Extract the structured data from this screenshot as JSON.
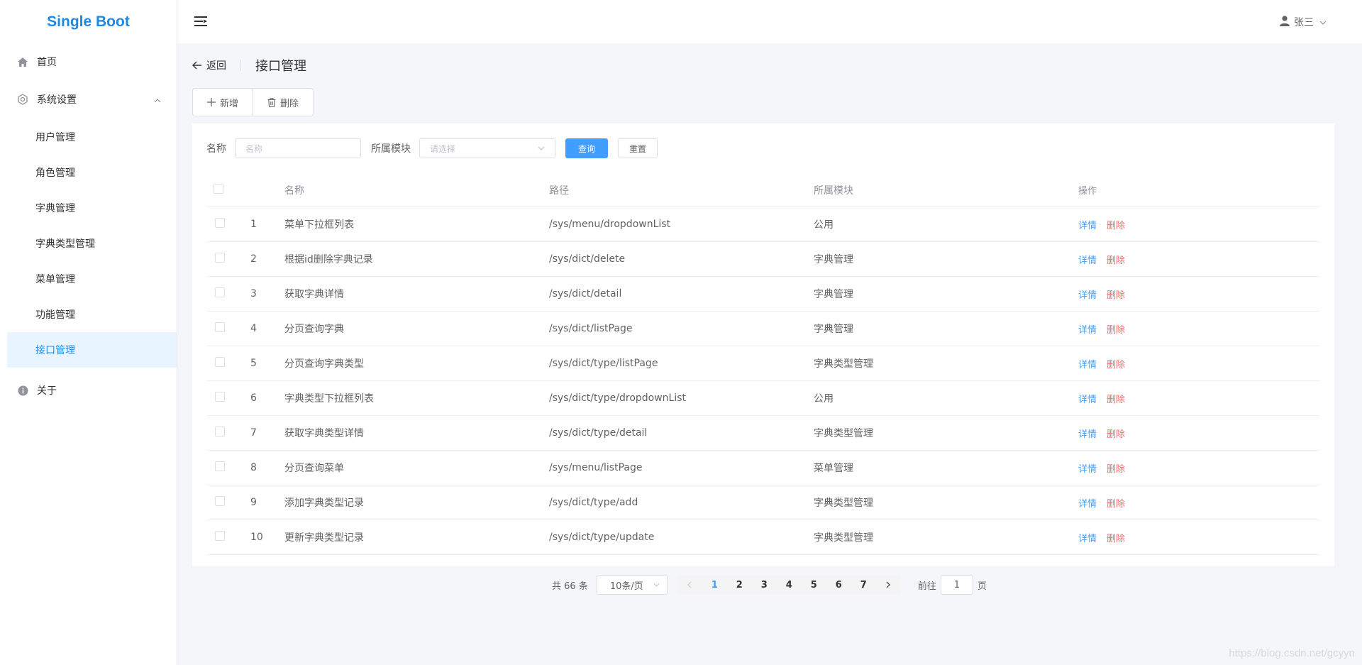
{
  "app": {
    "logo": "Single Boot"
  },
  "sidebar": {
    "home": "首页",
    "settings": "系统设置",
    "sub_items": [
      "用户管理",
      "角色管理",
      "字典管理",
      "字典类型管理",
      "菜单管理",
      "功能管理",
      "接口管理"
    ],
    "active_index": 6,
    "about": "关于"
  },
  "header": {
    "user_name": "张三"
  },
  "page_header": {
    "back_label": "返回",
    "title": "接口管理"
  },
  "toolbar": {
    "add_label": "新增",
    "delete_label": "删除"
  },
  "search": {
    "name_label": "名称",
    "name_placeholder": "名称",
    "module_label": "所属模块",
    "module_placeholder": "请选择",
    "query_label": "查询",
    "reset_label": "重置"
  },
  "table": {
    "columns": {
      "name": "名称",
      "path": "路径",
      "module": "所属模块",
      "actions": "操作"
    },
    "detail_label": "详情",
    "delete_label": "删除",
    "rows": [
      {
        "index": "1",
        "name": "菜单下拉框列表",
        "path": "/sys/menu/dropdownList",
        "module": "公用"
      },
      {
        "index": "2",
        "name": "根据id删除字典记录",
        "path": "/sys/dict/delete",
        "module": "字典管理"
      },
      {
        "index": "3",
        "name": "获取字典详情",
        "path": "/sys/dict/detail",
        "module": "字典管理"
      },
      {
        "index": "4",
        "name": "分页查询字典",
        "path": "/sys/dict/listPage",
        "module": "字典管理"
      },
      {
        "index": "5",
        "name": "分页查询字典类型",
        "path": "/sys/dict/type/listPage",
        "module": "字典类型管理"
      },
      {
        "index": "6",
        "name": "字典类型下拉框列表",
        "path": "/sys/dict/type/dropdownList",
        "module": "公用"
      },
      {
        "index": "7",
        "name": "获取字典类型详情",
        "path": "/sys/dict/type/detail",
        "module": "字典类型管理"
      },
      {
        "index": "8",
        "name": "分页查询菜单",
        "path": "/sys/menu/listPage",
        "module": "菜单管理"
      },
      {
        "index": "9",
        "name": "添加字典类型记录",
        "path": "/sys/dict/type/add",
        "module": "字典类型管理"
      },
      {
        "index": "10",
        "name": "更新字典类型记录",
        "path": "/sys/dict/type/update",
        "module": "字典类型管理"
      }
    ]
  },
  "pagination": {
    "total_text": "共 66 条",
    "page_size": "10条/页",
    "pages": [
      "1",
      "2",
      "3",
      "4",
      "5",
      "6",
      "7"
    ],
    "current": "1",
    "goto_label": "前往",
    "goto_value": "1",
    "page_suffix": "页"
  },
  "watermark": "https://blog.csdn.net/gcyyn",
  "colors": {
    "primary": "#409eff",
    "danger": "#f56c6c",
    "logo": "#1e88e5",
    "active_bg": "#e8f4ff"
  }
}
